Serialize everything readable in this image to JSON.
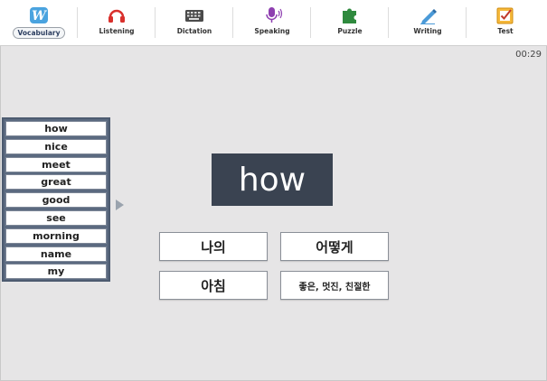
{
  "nav": {
    "logo_letter": "W",
    "items": [
      {
        "label": "Vocabulary",
        "icon": "vocabulary-logo-icon"
      },
      {
        "label": "Listening",
        "icon": "headphones-icon"
      },
      {
        "label": "Dictation",
        "icon": "keyboard-icon"
      },
      {
        "label": "Speaking",
        "icon": "microphone-icon"
      },
      {
        "label": "Puzzle",
        "icon": "puzzle-icon"
      },
      {
        "label": "Writing",
        "icon": "pencil-icon"
      },
      {
        "label": "Test",
        "icon": "checklist-icon"
      }
    ]
  },
  "timer": "00:29",
  "word_list": [
    "how",
    "nice",
    "meet",
    "great",
    "good",
    "see",
    "morning",
    "name",
    "my"
  ],
  "current_word": "how",
  "choices": [
    "나의",
    "어떻게",
    "아침",
    "좋은, 멋진, 친절한"
  ],
  "colors": {
    "background": "#e6e5e6",
    "word_card": "#3a4351",
    "word_list_frame": "#5b6a80"
  }
}
